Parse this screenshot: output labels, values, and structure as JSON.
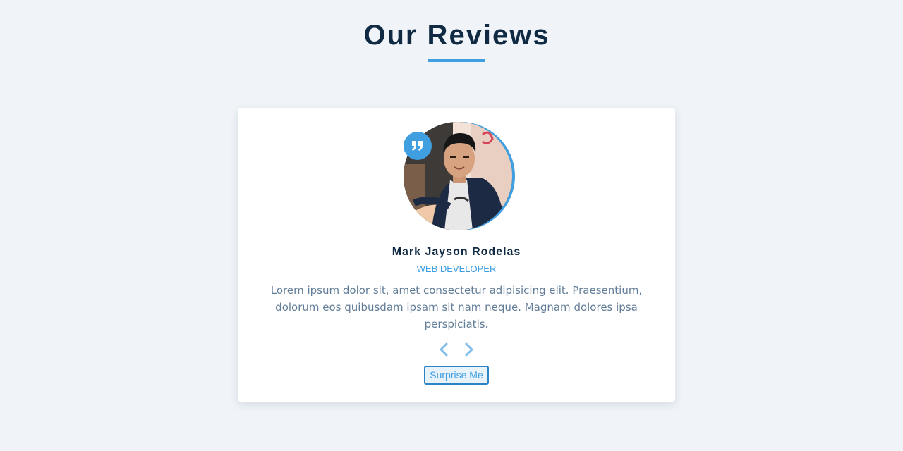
{
  "section": {
    "title": "Our Reviews",
    "accent_color": "#3f9fe0",
    "title_color": "#102a43",
    "background_color": "#f0f4f8"
  },
  "review": {
    "name": "Mark Jayson Rodelas",
    "job": "WEB DEVELOPER",
    "text": "Lorem ipsum dolor sit, amet consectetur adipisicing elit. Praesentium, dolorum eos quibusdam ipsam sit nam neque. Magnam dolores ipsa perspiciatis.",
    "avatar_icon": "person-photo",
    "quote_icon": "quote-right-icon"
  },
  "controls": {
    "prev_icon": "chevron-left-icon",
    "next_icon": "chevron-right-icon",
    "random_label": "Surprise Me"
  }
}
